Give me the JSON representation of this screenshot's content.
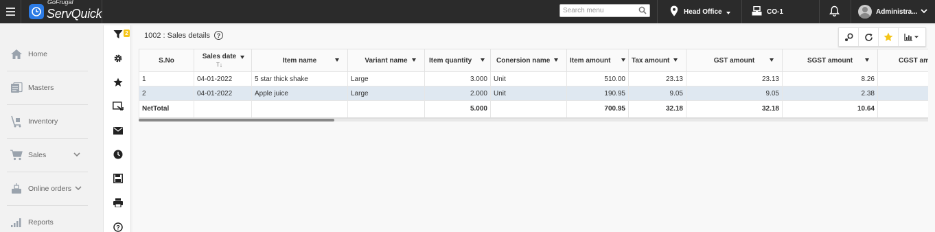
{
  "brand": {
    "small": "GoFrugal",
    "name": "ServQuick"
  },
  "topbar": {
    "search_placeholder": "Search menu",
    "location": "Head Office",
    "counter": "CO-1",
    "user": "Administra..."
  },
  "sidebar": {
    "items": [
      {
        "label": "Home",
        "icon": "home-icon",
        "has_chevron": false
      },
      {
        "label": "Masters",
        "icon": "masters-icon",
        "has_chevron": false
      },
      {
        "label": "Inventory",
        "icon": "inventory-icon",
        "has_chevron": false
      },
      {
        "label": "Sales",
        "icon": "cart-icon",
        "has_chevron": true
      },
      {
        "label": "Online orders",
        "icon": "online-orders-icon",
        "has_chevron": true
      },
      {
        "label": "Reports",
        "icon": "reports-icon",
        "has_chevron": false
      }
    ]
  },
  "toolbar": {
    "filter_count": "2",
    "tools": [
      "filter-icon",
      "settings-icon",
      "star-icon",
      "export-icon",
      "mail-icon",
      "clock-icon",
      "save-icon",
      "print-icon",
      "help-icon"
    ]
  },
  "page": {
    "title": "1002 : Sales details",
    "help": "?"
  },
  "actions": [
    "pivot-icon",
    "refresh-icon",
    "favorite-star-icon",
    "chart-dropdown-icon"
  ],
  "colors": {
    "accent": "#2c7be5",
    "star": "#f5c518",
    "selected_row": "#dfe8f1",
    "topbar": "#2b2b2b"
  },
  "table": {
    "columns": [
      "S.No",
      "Sales date",
      "Item name",
      "Variant name",
      "Item quantity",
      "Conersion name",
      "Item amount",
      "Tax amount",
      "GST amount",
      "SGST amount",
      "CGST am"
    ],
    "sales_date_sort": "T↓",
    "rows": [
      [
        "1",
        "04-01-2022",
        "5 star thick shake",
        "Large",
        "3.000",
        "Unit",
        "510.00",
        "23.13",
        "23.13",
        "8.26",
        ""
      ],
      [
        "2",
        "04-01-2022",
        "Apple juice",
        "Large",
        "2.000",
        "Unit",
        "190.95",
        "9.05",
        "9.05",
        "2.38",
        ""
      ]
    ],
    "total": [
      "NetTotal",
      "",
      "",
      "",
      "5.000",
      "",
      "700.95",
      "32.18",
      "32.18",
      "10.64",
      ""
    ]
  }
}
